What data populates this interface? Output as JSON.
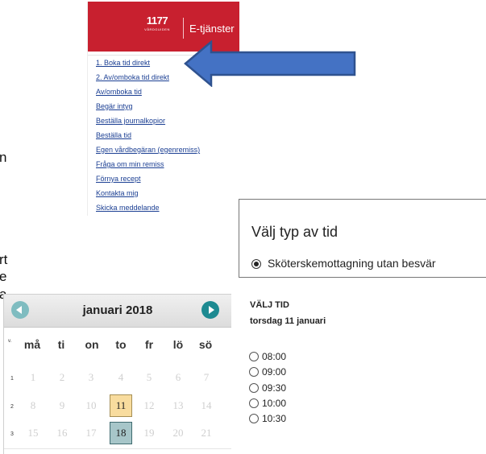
{
  "left_fragments": [
    "n",
    "rt",
    "e",
    "a"
  ],
  "menu": {
    "brand_number": "1177",
    "brand_sub": "VÅRDGUIDEN",
    "brand_title": "E-tjänster",
    "items": [
      "1. Boka tid direkt",
      "2. Av/omboka tid direkt",
      "Av/omboka tid",
      "Begär intyg",
      "Beställa journalkopior",
      "Beställa tid",
      "Egen vårdbegäran (egenremiss)",
      "Fråga om min remiss",
      "Förnya recept",
      "Kontakta mig",
      "Skicka meddelande"
    ]
  },
  "type_panel": {
    "title": "Välj typ av tid",
    "option": "Sköterskemottagning utan besvär"
  },
  "calendar": {
    "month": "januari 2018",
    "week_header": "v.",
    "weekdays": [
      "må",
      "ti",
      "on",
      "to",
      "fr",
      "lö",
      "sö"
    ],
    "weeks": [
      {
        "num": "1",
        "days": [
          "1",
          "2",
          "3",
          "4",
          "5",
          "6",
          "7"
        ]
      },
      {
        "num": "2",
        "days": [
          "8",
          "9",
          "10",
          "11",
          "12",
          "13",
          "14"
        ]
      },
      {
        "num": "3",
        "days": [
          "15",
          "16",
          "17",
          "18",
          "19",
          "20",
          "21"
        ]
      }
    ],
    "today": "11",
    "selected": "18"
  },
  "time_panel": {
    "heading": "VÄLJ TID",
    "date": "torsdag 11 januari",
    "times": [
      "08:00",
      "09:00",
      "09:30",
      "10:00",
      "10:30"
    ]
  },
  "colors": {
    "brand_red": "#c8202f",
    "link_blue": "#1b3f93",
    "arrow_blue": "#4472c4",
    "today_bg": "#f8dc9e",
    "selected_bg": "#a7c6c9",
    "nav_teal": "#1d8a91"
  }
}
